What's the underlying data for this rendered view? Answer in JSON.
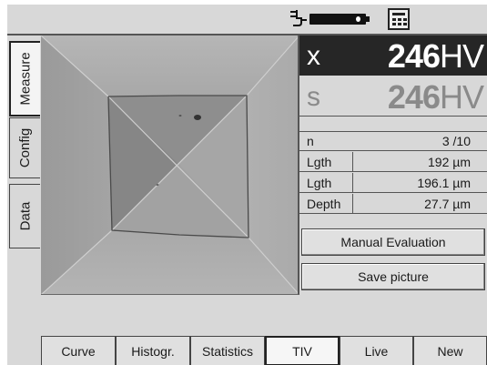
{
  "status": {
    "icons": [
      "plug-icon",
      "battery-icon",
      "calculator-icon"
    ]
  },
  "side_tabs": [
    {
      "label": "Measure",
      "active": true
    },
    {
      "label": "Config",
      "active": false
    },
    {
      "label": "Data",
      "active": false
    }
  ],
  "readout": {
    "x": {
      "symbol": "x",
      "value": "246",
      "unit": "HV"
    },
    "s": {
      "symbol": "s",
      "value": "246",
      "unit": "HV"
    },
    "rows": [
      {
        "label": "n",
        "value": "3 /10"
      },
      {
        "label": "Lgth",
        "value": "192 µm"
      },
      {
        "label": "Lgth",
        "value": "196.1 µm"
      },
      {
        "label": "Depth",
        "value": "27.7 µm"
      }
    ]
  },
  "actions": {
    "manual_evaluation": "Manual Evaluation",
    "save_picture": "Save picture"
  },
  "bottom_tabs": [
    {
      "label": "Curve",
      "active": false
    },
    {
      "label": "Histogr.",
      "active": false
    },
    {
      "label": "Statistics",
      "active": false
    },
    {
      "label": "TIV",
      "active": true
    },
    {
      "label": "Live",
      "active": false
    },
    {
      "label": "New",
      "active": false
    }
  ],
  "colors": {
    "screen_bg": "#d8d8d8",
    "highlight_bg": "#262626",
    "highlight_text": "#ffffff",
    "secondary_text": "#8a8a8a"
  }
}
